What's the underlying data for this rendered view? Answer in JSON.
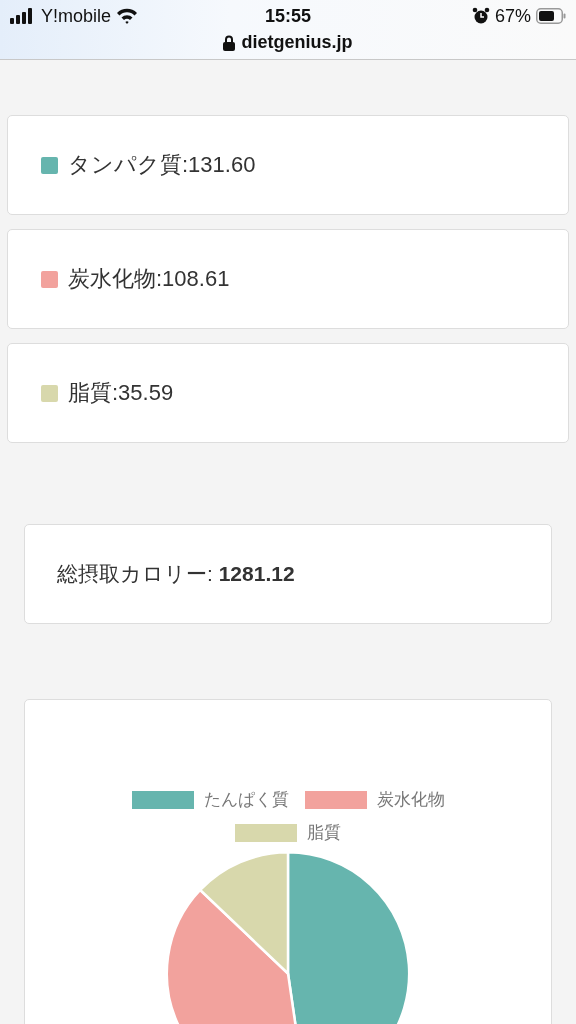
{
  "status_bar": {
    "carrier": "Y!mobile",
    "time": "15:55",
    "battery": "67%",
    "url": "dietgenius.jp"
  },
  "nutrients": [
    {
      "label": "タンパク質:131.60",
      "color": "#66b5ae"
    },
    {
      "label": "炭水化物:108.61",
      "color": "#f2a29d"
    },
    {
      "label": "脂質:35.59",
      "color": "#d8d8ac"
    }
  ],
  "total": {
    "text": "総摂取カロリー: **1281.12**"
  },
  "chart": {
    "chart_data": {
      "type": "pie",
      "categories": [
        "たんぱく質",
        "炭水化物",
        "脂質"
      ],
      "colors": [
        "#66b5ae",
        "#f2a29d",
        "#d8d8ac"
      ],
      "legend": "top",
      "series": [
        {
          "values": [
            47.7,
            39.4,
            12.9
          ]
        }
      ]
    }
  }
}
